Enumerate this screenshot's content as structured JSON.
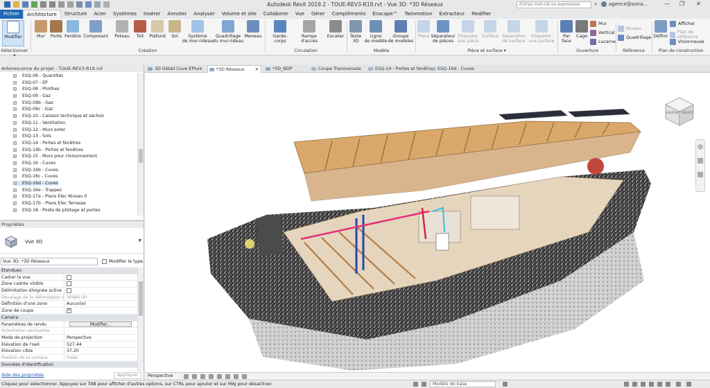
{
  "titlebar": {
    "title": "Autodesk Revit 2019.2 - TOUE-REV3-R19.rvt - Vue 3D: *3D Réseaux",
    "search_placeholder": "Entrez mot-clé ou expression",
    "user": "agence@sona...",
    "minimize": "—",
    "maximize": "❐",
    "close": "✕"
  },
  "menu": {
    "tabs": [
      "Fichier",
      "Architecture",
      "Structure",
      "Acier",
      "Systèmes",
      "Insérer",
      "Annoter",
      "Analyser",
      "Volume et site",
      "Collaborer",
      "Vue",
      "Gérer",
      "Compléments",
      "Enscape™",
      "Twinmotion",
      "Extracteur",
      "Modifier"
    ],
    "active": "Architecture"
  },
  "ribbon": {
    "modifier": "Modifier",
    "selectionner": "Sélectionner ▾",
    "creation": {
      "label": "Création",
      "buttons": [
        "Mur",
        "Porte",
        "Fenêtre",
        "Composant",
        "Poteau",
        "Toit",
        "Plafond",
        "Sol",
        "Système\nde mur-rideau",
        "Quadrillage\ndu mur-rideau",
        "Meneau"
      ]
    },
    "circulation": {
      "label": "Circulation",
      "buttons": [
        "Garde-corps",
        "Rampe d'accès",
        "Escalier"
      ]
    },
    "modele": {
      "label": "Modèle",
      "buttons": [
        "Texte\n3D",
        "Ligne\nde modèle",
        "Groupe\nde modèles"
      ]
    },
    "piece": {
      "label": "Pièce et surface ▾",
      "buttons": [
        "Pièce",
        "Séparateur\nde pièces",
        "Etiqueter\nune pièce",
        "Surface",
        "Séparation\nde surface",
        "Etiqueter\nune surface"
      ]
    },
    "ouverture": {
      "label": "Ouverture",
      "large": [
        "Par\nface",
        "Cage"
      ],
      "small": [
        "Mur",
        "Vertical",
        "Lucarne"
      ]
    },
    "reference": {
      "label": "Référence",
      "small": [
        "Niveau",
        "Quadrillage"
      ]
    },
    "plan": {
      "label": "Plan de construction",
      "large": "Définir",
      "small": [
        "Afficher",
        "Plan de référence",
        "Visionneuse"
      ]
    }
  },
  "browser": {
    "title": "Arborescence du projet - TOUE-REV3-R19.rvt",
    "items": [
      "ESQ-06 - Quantités",
      "ESQ-07 - EP",
      "ESQ-08 - Plinthes",
      "ESQ-09 - Gaz",
      "ESQ-09b - Gaz",
      "ESQ-09c - Gaz",
      "ESQ-10 - Caisson technique et séchoir",
      "ESQ-11 - Ventilation",
      "ESQ-12 - Murs exter",
      "ESQ-13 - Sols",
      "ESQ-14 - Portes et fenêtres",
      "ESQ-14b - Portes et fenêtres",
      "ESQ-15 - Murs pour cloisonnement",
      "ESQ-16 - Cuves",
      "ESQ-16b - Cuves",
      "ESQ-16c - Cuves",
      "ESQ-16d - Cuves",
      "ESQ-16e - Trappes",
      "ESQ-17a - Plans Elec Niveau 0",
      "ESQ-17b - Plans Elec Terrasse",
      "ESQ-18 - Poste de pilotage et portes"
    ],
    "selected_index": 16
  },
  "properties": {
    "title": "Propriétés",
    "type": "Vue 3D",
    "instance": "Vue 3D: *3D Réseaux",
    "edit_type": "Modifier le type",
    "rows": [
      {
        "cat": true,
        "k": "Etendues",
        "v": ""
      },
      {
        "k": "Cadrer la vue",
        "cb": false
      },
      {
        "k": "Zone cadrée visible",
        "cb": false
      },
      {
        "k": "Délimitation éloignée active",
        "cb": false
      },
      {
        "k": "Décalage de la délimitation él...",
        "v": "30480.00",
        "gray": true
      },
      {
        "k": "Définition d'une zone",
        "v": "Aucun(e)"
      },
      {
        "k": "Zone de coupe",
        "cb": true
      },
      {
        "cat": true,
        "k": "Caméra",
        "v": ""
      },
      {
        "k": "Paramètres de rendu",
        "btn": "Modifier..."
      },
      {
        "k": "Orientation verrouillée",
        "v": "",
        "gray": true
      },
      {
        "k": "Mode de projection",
        "v": "Perspective"
      },
      {
        "k": "Elévation de l'oeil",
        "v": "527.44"
      },
      {
        "k": "Elévation cible",
        "v": "37.20"
      },
      {
        "k": "Position de la caméra",
        "v": "Fixée",
        "gray": true
      },
      {
        "cat": true,
        "k": "Données d'identification",
        "v": ""
      }
    ],
    "help_link": "Aide des propriétés",
    "apply": "Appliquer"
  },
  "viewtabs": [
    {
      "label": "3D Détail Cuve EPluie",
      "active": false
    },
    {
      "label": "*3D Réseaux",
      "active": true,
      "close": "✕"
    },
    {
      "label": "*3D_NDP",
      "active": false
    },
    {
      "label": "Coupe Transversale",
      "active": false
    },
    {
      "label": "ESQ-14 - Portes et fenêtres",
      "active": false
    },
    {
      "label": "ESQ-16d - Cuves",
      "active": false
    }
  ],
  "viewcube": {
    "face_left": "GAUCHE",
    "face_right": "DROITE"
  },
  "viewbar": {
    "mode": "Perspective"
  },
  "statusbar": {
    "message": "Cliquez pour sélectionner. Appuyez sur TAB pour afficher d'autres options, sur CTRL pour ajouter et sur MAJ pour désactiver.",
    "model": "Modèle de base"
  },
  "colors": {
    "accent": "#2066b6",
    "wood": "#c8965e",
    "roof": "#d9a86a"
  }
}
